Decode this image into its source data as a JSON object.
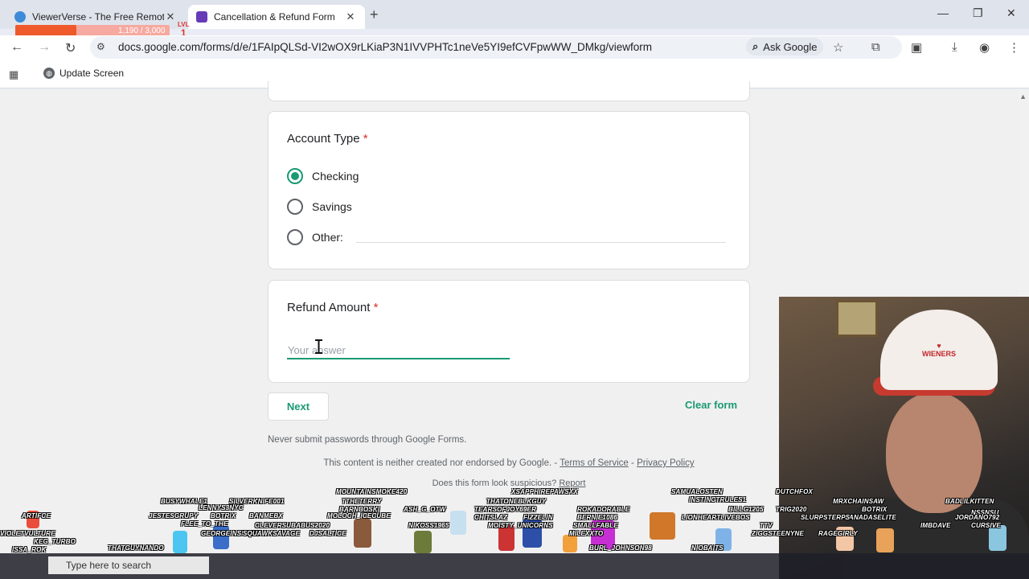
{
  "browser": {
    "tabs": [
      {
        "title": "ViewerVerse - The Free Remote",
        "active": false
      },
      {
        "title": "Cancellation & Refund Form",
        "active": true
      }
    ],
    "url": "docs.google.com/forms/d/e/1FAIpQLSd-VI2wOX9rLKiaP3N1IVVPHTc1neVe5YI9efCVFpwWW_DMkg/viewform",
    "ask_google_label": "Ask Google",
    "bookmarks": [
      {
        "label": "Update Screen"
      }
    ]
  },
  "overlay": {
    "xp_text": "1,190 / 3,000",
    "xp_fraction": 0.397,
    "level_label": "LVL",
    "level_value": "1"
  },
  "form": {
    "account_type": {
      "title": "Account Type",
      "required_mark": "*",
      "options": [
        {
          "label": "Checking",
          "selected": true
        },
        {
          "label": "Savings",
          "selected": false
        },
        {
          "label": "Other:",
          "selected": false
        }
      ]
    },
    "refund_amount": {
      "title": "Refund Amount",
      "required_mark": "*",
      "placeholder": "Your answer",
      "value": ""
    },
    "next_label": "Next",
    "clear_label": "Clear form",
    "footnote": "Never submit passwords through Google Forms.",
    "disclaimer": "This content is neither created nor endorsed by Google. -",
    "terms_label": "Terms of Service",
    "separator": "-",
    "privacy_label": "Privacy Policy",
    "suspicious_text": "Does this form look suspicious?",
    "report_label": "Report"
  },
  "colors": {
    "accent": "#1a9a73",
    "required": "#d93025",
    "xp_fill": "#ee5a2b"
  },
  "chatters": [
    "BUSYWHALE1",
    "SILVERKNIFE001",
    "MOUNTAINSMOKE420",
    "THATONEBLKGUY",
    "SAMUALOSTEN",
    "DUTCHFOX",
    "ARTIFCE",
    "LENNYS3NYC",
    "TTHETERRY",
    "XSAPPHIREPAWSXX",
    "INSTINCTRULES1",
    "MRXCHAINSAW",
    "BADLILKITTEN",
    "JESTESGRUPY",
    "BOTRIX",
    "BARNBOSKI",
    "ASH_G_OTW",
    "TEARSOFJOY69ER",
    "ROKADORABLE",
    "BILLG1205",
    "TRIG2020",
    "BOTRIX",
    "VIOLETVULTURE",
    "FLEE_TO_THE",
    "BANMEBX",
    "MOLOCH_ICECUBE",
    "BERNIE1086",
    "LIONHEARTLIVEBOS",
    "CANADASELITE",
    "NSSNSU",
    "KEG_TURBO",
    "GEORGEINSPACE",
    "CLEVERSUBABUS2020",
    "NIKOSS1965",
    "CHITSLAZ",
    "FIZZELIN",
    "SMALLFABLE",
    "TTV",
    "SLURPSTERPS",
    "ISSA_ROK",
    "SQUAWKSAVAGE",
    "MOISTY_UNICORNS",
    "ZIGGSTEENYNE",
    "JORDANO792",
    "THATGUYNANDO",
    "DJSALTICE",
    "MILEXXTO",
    "IMBDAVE",
    "CURSIVE",
    "BURL_JOHNSON98",
    "NIOBAITS",
    "RAGEGIRLY"
  ],
  "taskbar": {
    "search_placeholder": "Type here to search"
  }
}
